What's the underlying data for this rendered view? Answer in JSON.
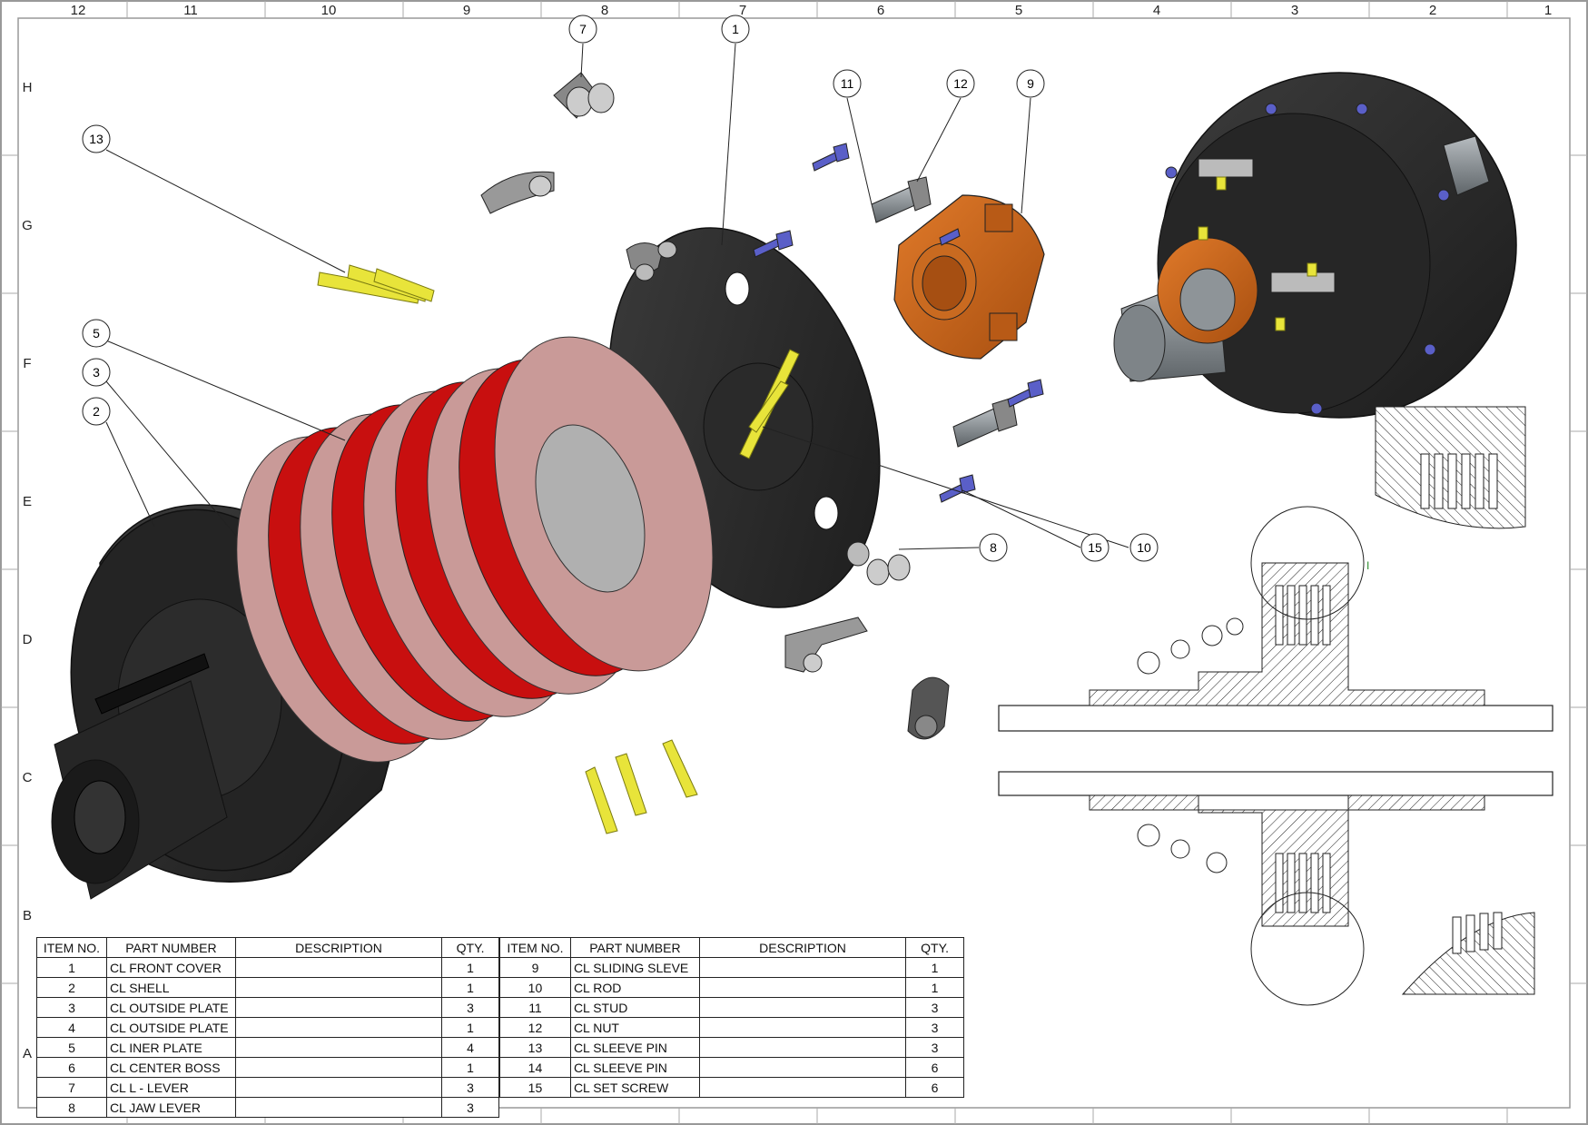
{
  "border": {
    "columns": [
      "12",
      "11",
      "10",
      "9",
      "8",
      "7",
      "6",
      "5",
      "4",
      "3",
      "2",
      "1"
    ],
    "rows": [
      "H",
      "G",
      "F",
      "E",
      "D",
      "C",
      "B",
      "A"
    ]
  },
  "balloons": {
    "b1": "1",
    "b2": "2",
    "b3": "3",
    "b5": "5",
    "b7": "7",
    "b8": "8",
    "b9": "9",
    "b10": "10",
    "b11": "11",
    "b12": "12",
    "b13": "13",
    "b15": "15"
  },
  "detail_label": "I",
  "bom": {
    "headers": [
      "ITEM NO.",
      "PART NUMBER",
      "DESCRIPTION",
      "QTY."
    ],
    "left": [
      {
        "item": "1",
        "part": "CL FRONT COVER",
        "desc": "",
        "qty": "1"
      },
      {
        "item": "2",
        "part": "CL SHELL",
        "desc": "",
        "qty": "1"
      },
      {
        "item": "3",
        "part": "CL OUTSIDE PLATE",
        "desc": "",
        "qty": "3"
      },
      {
        "item": "4",
        "part": "CL OUTSIDE PLATE",
        "desc": "",
        "qty": "1"
      },
      {
        "item": "5",
        "part": "CL INER PLATE",
        "desc": "",
        "qty": "4"
      },
      {
        "item": "6",
        "part": "CL CENTER BOSS",
        "desc": "",
        "qty": "1"
      },
      {
        "item": "7",
        "part": "CL L - LEVER",
        "desc": "",
        "qty": "3"
      },
      {
        "item": "8",
        "part": "CL JAW LEVER",
        "desc": "",
        "qty": "3"
      }
    ],
    "right": [
      {
        "item": "9",
        "part": "CL SLIDING SLEVE",
        "desc": "",
        "qty": "1"
      },
      {
        "item": "10",
        "part": "CL ROD",
        "desc": "",
        "qty": "1"
      },
      {
        "item": "11",
        "part": "CL STUD",
        "desc": "",
        "qty": "3"
      },
      {
        "item": "12",
        "part": "CL NUT",
        "desc": "",
        "qty": "3"
      },
      {
        "item": "13",
        "part": "CL SLEEVE PIN",
        "desc": "",
        "qty": "3"
      },
      {
        "item": "14",
        "part": "CL SLEEVE PIN",
        "desc": "",
        "qty": "6"
      },
      {
        "item": "15",
        "part": "CL SET SCREW",
        "desc": "",
        "qty": "6"
      }
    ]
  },
  "colors": {
    "black_part": "#2b2b2b",
    "red_plate": "#c80f0f",
    "pink_plate": "#c99a98",
    "orange_sleeve": "#c8661c",
    "yellow_pin": "#e8e43a",
    "blue_screw": "#5a5fc8",
    "grey_shaft": "#8e9498"
  }
}
